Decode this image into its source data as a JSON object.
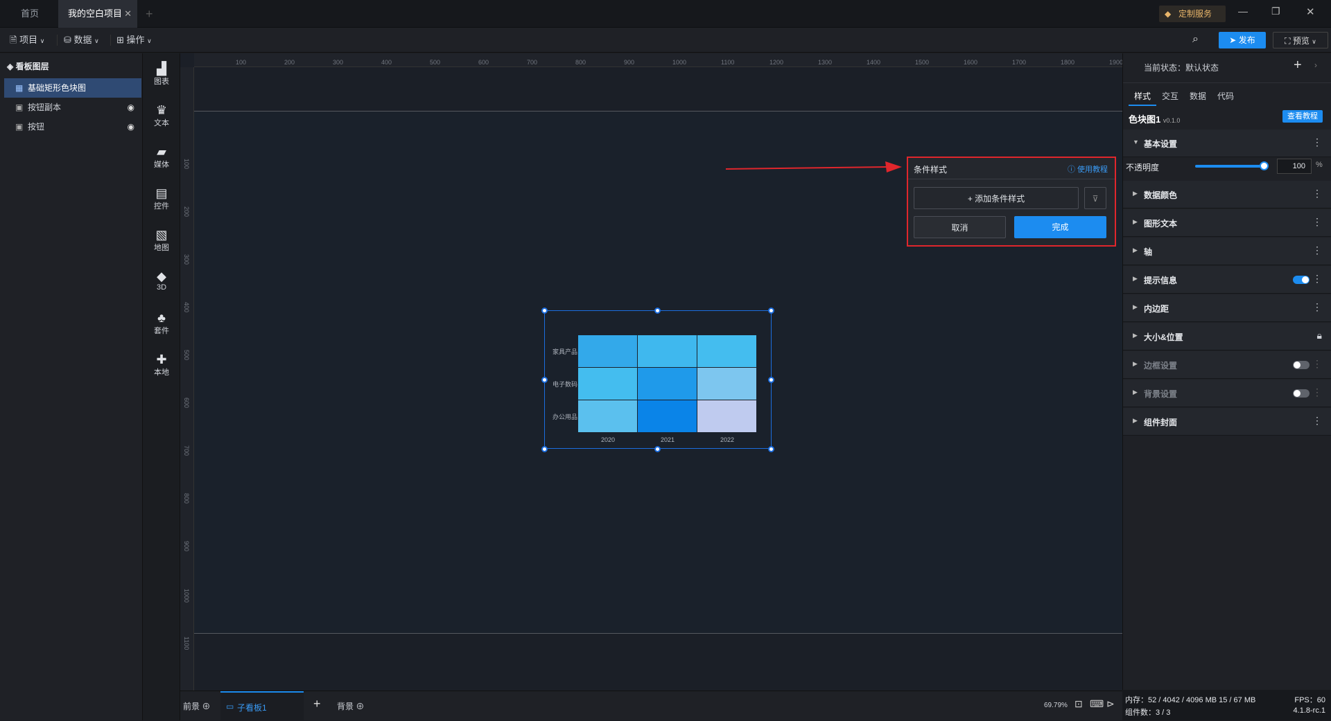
{
  "tabs": {
    "home": "首页",
    "project": "我的空白项目"
  },
  "custom_service": "定制服务",
  "menu": {
    "project": "项目",
    "data": "数据",
    "operate": "操作"
  },
  "toolbar": {
    "publish": "发布",
    "preview": "预览"
  },
  "layers": {
    "title": "看板图层",
    "items": [
      {
        "label": "基础矩形色块图"
      },
      {
        "label": "按钮副本"
      },
      {
        "label": "按钮"
      }
    ]
  },
  "palette": [
    {
      "label": "图表"
    },
    {
      "label": "文本"
    },
    {
      "label": "媒体"
    },
    {
      "label": "控件"
    },
    {
      "label": "地图"
    },
    {
      "label": "3D"
    },
    {
      "label": "套件"
    },
    {
      "label": "本地"
    }
  ],
  "ruler_top": [
    "100",
    "200",
    "300",
    "400",
    "500",
    "600",
    "700",
    "800",
    "900",
    "1000",
    "1100",
    "1200",
    "1300",
    "1400",
    "1500",
    "1600",
    "1700",
    "1800",
    "1900"
  ],
  "ruler_left": [
    "100",
    "200",
    "300",
    "400",
    "500",
    "600",
    "700",
    "800",
    "900",
    "1000",
    "1100"
  ],
  "chart_data": {
    "type": "heatmap",
    "x_categories": [
      "2020",
      "2021",
      "2022"
    ],
    "y_categories": [
      "家具产品",
      "电子数码",
      "办公用品"
    ],
    "cell_colors": [
      [
        "#33a9ea",
        "#3fb8ee",
        "#44bdef"
      ],
      [
        "#44bdef",
        "#1f9aea",
        "#7dc6ef"
      ],
      [
        "#5bc0ee",
        "#0a84e8",
        "#bfcbef"
      ]
    ]
  },
  "cond_panel": {
    "title": "条件样式",
    "help": "使用教程",
    "add": "添加条件样式",
    "cancel": "取消",
    "done": "完成"
  },
  "bottom": {
    "front": "前景",
    "board": "子看板1",
    "back": "背景",
    "zoom": "69.79%"
  },
  "right": {
    "state_label": "当前状态：",
    "state_value": "默认状态",
    "tabs": [
      "样式",
      "交互",
      "数据",
      "代码"
    ],
    "component_name": "色块图1",
    "version": "v0.1.0",
    "tutorial": "查看教程",
    "basic": "基本设置",
    "opacity_label": "不透明度",
    "opacity_value": "100",
    "opacity_unit": "%",
    "opacity_level": 1.0,
    "sections": [
      "数据颜色",
      "图形文本",
      "轴",
      "提示信息",
      "内边距",
      "大小&位置",
      "边框设置",
      "背景设置",
      "组件封面"
    ]
  },
  "status": {
    "memory": "内存：52 / 4042 / 4096 MB 15 / 67 MB",
    "fps": "FPS：60",
    "count": "组件数：3 / 3",
    "version": "4.1.8-rc.1"
  },
  "colors": {
    "accent": "#1c8cf0",
    "annotation": "#e0262c",
    "selection": "#1c6ee0"
  }
}
